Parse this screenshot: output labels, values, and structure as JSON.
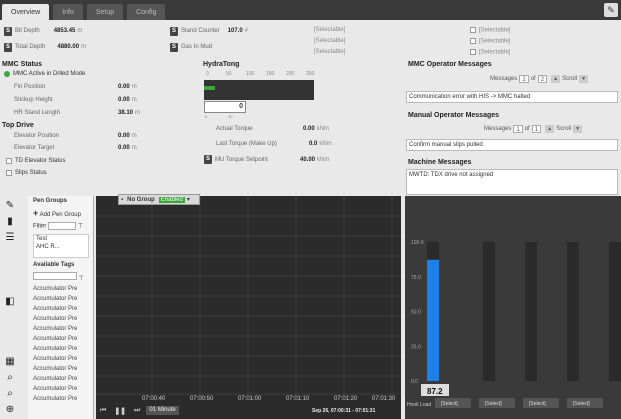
{
  "tabs": [
    "Overview",
    "Info",
    "Setup",
    "Config"
  ],
  "top": {
    "bit_depth_label": "Bit Depth",
    "bit_depth_value": "4853.45",
    "bit_depth_unit": "m",
    "total_depth_label": "Total Depth",
    "total_depth_value": "4880.00",
    "total_depth_unit": "m",
    "stand_counter_label": "Stand Counter",
    "stand_counter_value": "107.0",
    "stand_counter_unit": "#",
    "gas_in_mud_label": "Gas In Mud",
    "selectable": "[Selectable]"
  },
  "mmc": {
    "title": "MMC Status",
    "active": "MMC Active in Drlled Mode",
    "fin_position": "Fin Position",
    "fin_value": "0.00",
    "stickup_height": "Stickup Height",
    "stickup_value": "0.00",
    "hr_stand_length": "HR Stand Length",
    "hr_value": "38.10",
    "unit": "m"
  },
  "topdrive": {
    "title": "Top Drive",
    "elevator_position": "Elevator Position",
    "elevator_value": "0.00",
    "elevator_target": "Elevator Target",
    "target_value": "0.00",
    "unit": "m",
    "td_elevator_status": "TD Elevator Status",
    "slips_status": "Slips Status"
  },
  "hydratong": {
    "title": "HydraTong",
    "scale": [
      "0",
      "50",
      "100",
      "150",
      "200",
      "250"
    ],
    "torque_box": "0",
    "torque_min": "0",
    "torque_max": "40",
    "actual_torque_label": "Actual Torque",
    "actual_torque_value": "0.00",
    "last_torque_label": "Last Torque (Make Up)",
    "last_torque_value": "0.0",
    "mu_setpoint_label": "MU Torque Setpoint",
    "mu_setpoint_value": "40.00",
    "torque_unit": "kNm",
    "fill_fraction": 0.1
  },
  "mmc_operator": {
    "title": "MMC Operator Messages",
    "messages_label": "Messages",
    "current": "2",
    "of": "of",
    "total": "2",
    "scroll": "Scroll",
    "message": "Communication error with HIS -> MMC halted"
  },
  "manual_operator": {
    "title": "Manual Operator Messages",
    "messages_label": "Messages",
    "current": "1",
    "of": "of",
    "total": "1",
    "scroll": "Scroll",
    "message": "Confirm manual slips pulled"
  },
  "machine": {
    "title": "Machine Messages",
    "message": "MWTD: TDX drive not assigned"
  },
  "pen_groups": {
    "title": "Pen Groups",
    "add": "Add Pen Group",
    "filter": "Filter",
    "items": [
      "Test",
      "AHC R..."
    ],
    "available_tags": "Available Tags",
    "tags": [
      "Accumulator Pre",
      "Accumulator Pre",
      "Accumulator Pre",
      "Accumulator Pre",
      "Accumulator Pre",
      "Accumulator Pre",
      "Accumulator Pre",
      "Accumulator Pre",
      "Accumulator Pre",
      "Accumulator Pre",
      "Accumulator Pre",
      "Accumulator Pre"
    ]
  },
  "trend": {
    "group_label": "No Group",
    "group_status": "Enabled",
    "times": [
      "07:00:40",
      "07:00:50",
      "07:01:00",
      "07:01:10",
      "07:01:20",
      "07:01:30"
    ],
    "range": "01 Minute",
    "date_range": "Sep 26, 07:00:31 - 07:01:31"
  },
  "bars": {
    "axis": [
      "100.0",
      "75.0",
      "50.0",
      "25.0",
      "0.0"
    ],
    "value_label": "87.2",
    "bar_values": [
      87.2,
      100,
      100,
      100,
      100
    ],
    "hook_label": "Hook Load",
    "select_labels": [
      "[Select]",
      "[Select]",
      "[Select]",
      "[Select]"
    ]
  }
}
